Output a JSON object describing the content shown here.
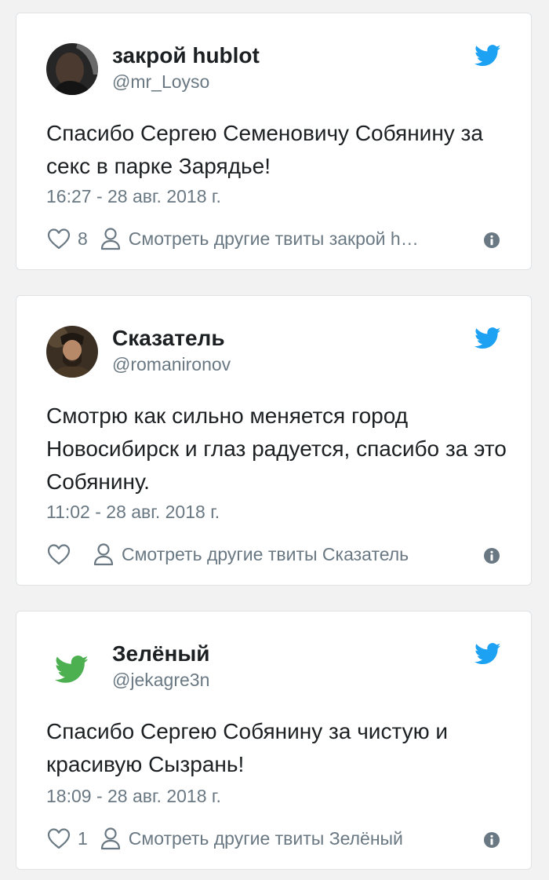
{
  "tweets": [
    {
      "name": "закрой hublot",
      "handle": "@mr_Loyso",
      "text": "Спасибо Сергею Семеновичу Собянину за секс в парке Зарядье!",
      "date": "16:27 - 28 авг. 2018 г.",
      "likes": "8",
      "more": "Смотреть другие твиты закрой h…",
      "avatar": "dark-portrait"
    },
    {
      "name": "Сказатель",
      "handle": "@romanironov",
      "text": "Смотрю как сильно меняется город Новосибирск и глаз радуется, спасибо за это Собянину.",
      "date": "11:02 - 28 авг. 2018 г.",
      "likes": "",
      "more": "Смотреть другие твиты Сказатель",
      "avatar": "painted-portrait"
    },
    {
      "name": "Зелёный",
      "handle": "@jekagre3n",
      "text": "Спасибо Сергею Собянину за чистую и красивую Сызрань!",
      "date": "18:09 - 28 авг. 2018 г.",
      "likes": "1",
      "more": "Смотреть другие твиты Зелёный",
      "avatar": "green-bird"
    }
  ],
  "icons": {
    "brand": "twitter-bird-icon",
    "like": "heart-icon",
    "profile": "person-icon",
    "info": "info-icon"
  },
  "colors": {
    "twitter_blue": "#1da1f2",
    "secondary_text": "#697882",
    "avatar_green": "#4caf50"
  }
}
